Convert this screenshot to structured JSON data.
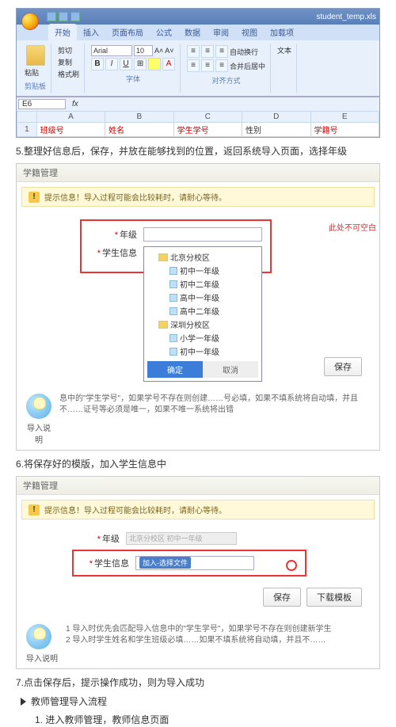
{
  "excel": {
    "filename": "student_temp.xls",
    "tabs": [
      "开始",
      "插入",
      "页面布局",
      "公式",
      "数据",
      "审阅",
      "视图",
      "加载项"
    ],
    "active_tab": "开始",
    "clipboard": {
      "paste": "粘贴",
      "cut": "剪切",
      "copy": "复制",
      "format": "格式刷",
      "group": "剪贴板"
    },
    "font": {
      "name": "Arial",
      "size": "10",
      "group": "字体",
      "bold": "B",
      "italic": "I",
      "underline": "U"
    },
    "align": {
      "group": "对齐方式",
      "wrap": "自动换行",
      "merge": "合并后居中"
    },
    "number_group": "文本",
    "name_box": "E6",
    "fx": "fx",
    "cols": [
      "A",
      "B",
      "C",
      "D",
      "E"
    ],
    "row1": [
      "班级号",
      "姓名",
      "学生学号",
      "性别",
      "学籍号"
    ],
    "rowh": "1"
  },
  "step5": "5.整理好信息后，保存，并放在能够找到的位置，返回系统导入页面，选择年级",
  "panel1": {
    "title": "学籍管理",
    "warning": "提示信息！导入过程可能会比较耗时，请耐心等待。",
    "grade_label": "年级",
    "info_label": "学生信息",
    "note_right": "此处不可空白",
    "tree": {
      "root1": "北京分校区",
      "n1": "初中一年级",
      "n2": "初中二年级",
      "n3": "高中一年级",
      "n4": "高中二年级",
      "root2": "深圳分校区",
      "n5": "小学一年级",
      "n6": "初中一年级",
      "ok": "确定",
      "cancel": "取消"
    },
    "save": "保存",
    "import_title": "导入说明",
    "import_desc": "息中的\"学生学号\"，如果学号不存在则创建……号必填，如果不填系统将自动填，并且不……证号等必须是唯一，如果不唯一系统将出错"
  },
  "step6": "6.将保存好的模版，加入学生信息中",
  "panel2": {
    "title": "学籍管理",
    "warning": "提示信息！导入过程可能会比较耗时，请耐心等待。",
    "grade_label": "年级",
    "grade_value": "北京分校区 初中一年级",
    "info_label": "学生信息",
    "upload_chip": "加入-选择文件",
    "save": "保存",
    "dl": "下载模板",
    "import_title": "导入说明",
    "import_desc": "1 导入时优先会匹配导入信息中的\"学生学号\"，如果学号不存在则创建新学生\n2 导入时学生姓名和学生班级必填……如果不填系统将自动填，并且不……"
  },
  "step7": "7.点击保存后，提示操作成功，则为导入成功",
  "section": "教师管理导入流程",
  "sub1": "1.  进入教师管理，教师信息页面"
}
